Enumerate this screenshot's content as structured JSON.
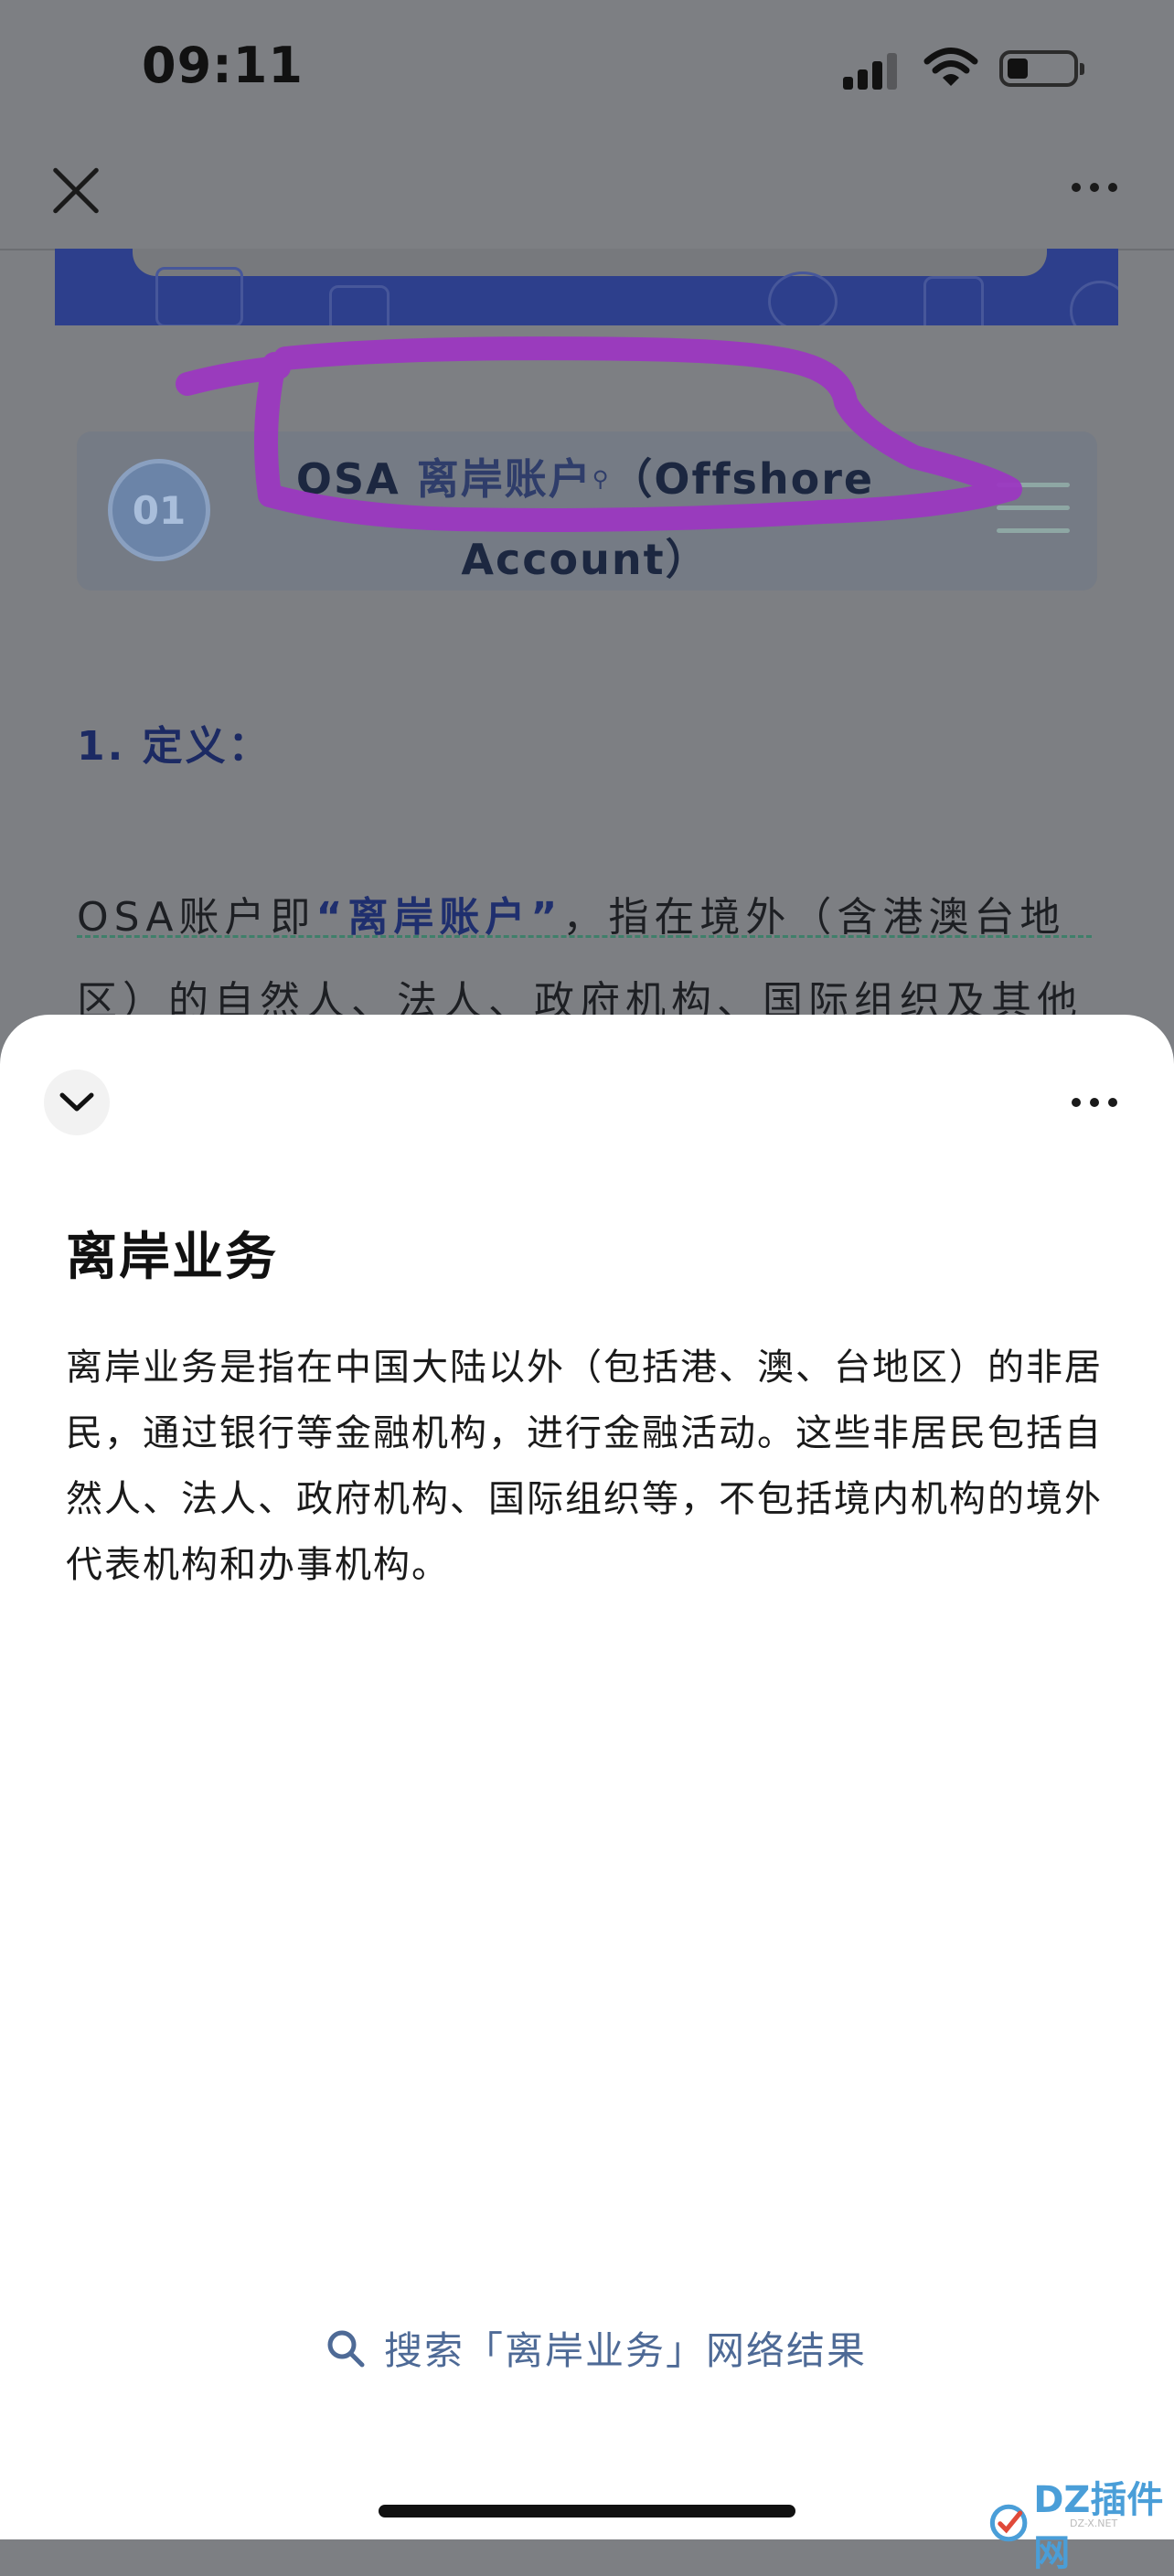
{
  "status_bar": {
    "time": "09:11"
  },
  "article": {
    "section_number": "01",
    "section_title_osa": "OSA",
    "section_title_highlight": "离岸账户",
    "section_title_line1_rest": "（Offshore",
    "section_title_line2": "Account）",
    "definition_heading": "1. 定义：",
    "para_line1_pre": "OSA账户即",
    "para_line1_keyword": "“离岸账户”",
    "para_line1_post": "，指在境外（含港澳台地",
    "para_line2": "区）的自然人、法人、政府机构、国际组织及其他经"
  },
  "sheet": {
    "title": "离岸业务",
    "body": "离岸业务是指在中国大陆以外（包括港、澳、台地区）的非居民，通过银行等金融机构，进行金融活动。这些非居民包括自然人、法人、政府机构、国际组织等，不包括境内机构的境外代表机构和办事机构。",
    "search_label": "搜索「离岸业务」网络结果"
  },
  "watermark": {
    "text": "DZ插件网",
    "sub": "DZ-X.NET"
  },
  "colors": {
    "overlay_gray": "#7d7f83",
    "banner_blue": "#2d3f8c",
    "marker_purple": "#9c35c2",
    "link_blue": "#4e6a96",
    "keyword_blue": "#1f2f6e"
  },
  "icons": [
    "close-icon",
    "more-icon",
    "chevron-down-icon",
    "search-icon",
    "signal-icon",
    "wifi-icon",
    "battery-icon",
    "menu-icon"
  ]
}
